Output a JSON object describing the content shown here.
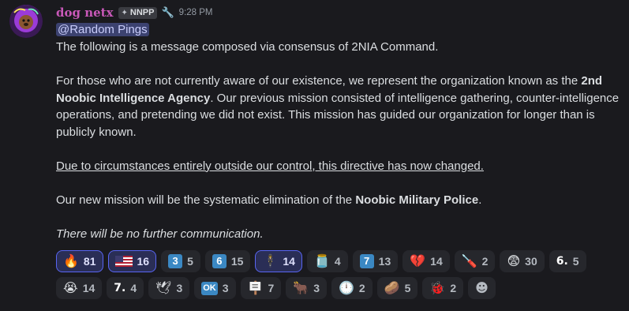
{
  "message": {
    "username": "dog netx",
    "tag": "NNPP",
    "timestamp": "9:28 PM",
    "mention": "@Random Pings",
    "line1": "The following is a message composed via consensus of 2NIA Command.",
    "p2_a": "For those who are not currently aware of our existence, we represent the organization known as the ",
    "p2_bold": "2nd Noobic Intelligence Agency",
    "p2_b": ". Our previous mission consisted of intelligence gathering, counter-intelligence operations, and pretending we did not exist. This mission has guided our organization for longer than is publicly known.",
    "p3": "Due to circumstances entirely outside our control, this directive has now changed.",
    "p4_a": "Our new mission will be the systematic elimination of the ",
    "p4_bold": "Noobic Military Police",
    "p4_b": ".",
    "p5": "There will be no further communication."
  },
  "reactions": [
    {
      "icon": "fire-icon",
      "glyph": "🔥",
      "count": "81",
      "me": true
    },
    {
      "icon": "us-flag-icon",
      "glyph": "",
      "count": "16",
      "me": true
    },
    {
      "icon": "keycap-3-icon",
      "glyph": "3",
      "count": "5",
      "me": false
    },
    {
      "icon": "keycap-6-icon",
      "glyph": "6",
      "count": "15",
      "me": false
    },
    {
      "icon": "custom-portrait-icon",
      "glyph": "🕴",
      "count": "14",
      "me": true
    },
    {
      "icon": "jar-icon",
      "glyph": "🫙",
      "count": "4",
      "me": false
    },
    {
      "icon": "keycap-7-icon",
      "glyph": "7",
      "count": "13",
      "me": false
    },
    {
      "icon": "broken-heart-icon",
      "glyph": "💔",
      "count": "14",
      "me": false
    },
    {
      "icon": "screwdriver-icon",
      "glyph": "🪛",
      "count": "2",
      "me": false
    },
    {
      "icon": "fearful-face-icon",
      "glyph": "😨",
      "count": "30",
      "me": false
    },
    {
      "icon": "digit-6-icon",
      "glyph": "6.",
      "count": "5",
      "me": false
    },
    {
      "icon": "sobbing-face-icon",
      "glyph": "😭",
      "count": "14",
      "me": false
    },
    {
      "icon": "digit-7-icon",
      "glyph": "7.",
      "count": "4",
      "me": false
    },
    {
      "icon": "dove-icon",
      "glyph": "🕊",
      "count": "3",
      "me": false
    },
    {
      "icon": "ok-button-icon",
      "glyph": "OK",
      "count": "3",
      "me": false
    },
    {
      "icon": "custom-sign-icon",
      "glyph": "🪧",
      "count": "7",
      "me": false
    },
    {
      "icon": "bull-icon",
      "glyph": "🐂",
      "count": "3",
      "me": false
    },
    {
      "icon": "clock-icon",
      "glyph": "🕛",
      "count": "2",
      "me": false
    },
    {
      "icon": "bread-icon",
      "glyph": "🥔",
      "count": "5",
      "me": false
    },
    {
      "icon": "bug-icon",
      "glyph": "🐞",
      "count": "2",
      "me": false
    }
  ],
  "colors": {
    "username": "#c858b8",
    "mention_bg": "#3c4270",
    "reaction_me_border": "#5865f2"
  }
}
